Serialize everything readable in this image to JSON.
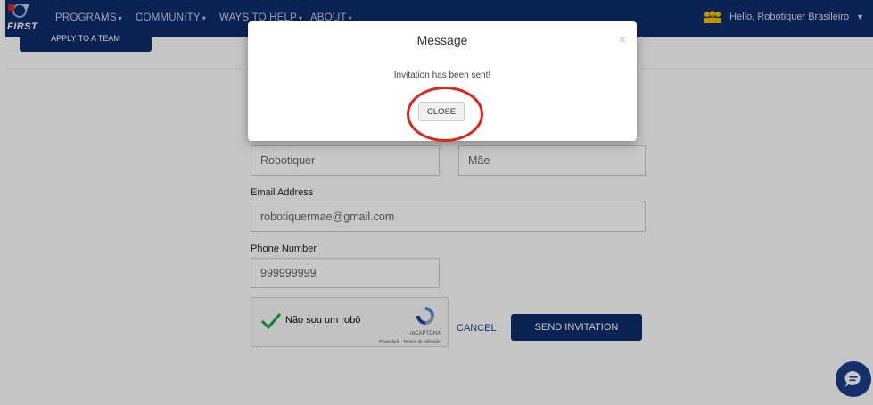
{
  "navbar": {
    "logo_text": "FIRST",
    "items": [
      {
        "label": "PROGRAMS"
      },
      {
        "label": "COMMUNITY"
      },
      {
        "label": "WAYS TO HELP"
      },
      {
        "label": "ABOUT"
      }
    ],
    "greeting": "Hello, Robotiquer Brasileiro"
  },
  "page": {
    "apply_button_label": "APPLY TO A TEAM"
  },
  "form": {
    "first_name_value": "Robotiquer",
    "last_name_value": "Mãe",
    "email_label": "Email Address",
    "email_value": "robotiquermae@gmail.com",
    "phone_label": "Phone Number",
    "phone_value": "999999999",
    "recaptcha": {
      "label": "Não sou um robô",
      "brand": "reCAPTCHA",
      "links": "Privacidade - Termos de Utilização"
    },
    "cancel_label": "CANCEL",
    "send_label": "SEND INVITATION"
  },
  "modal": {
    "title": "Message",
    "close_glyph": "×",
    "message": "Invitation has been sent!",
    "close_button_label": "CLOSE"
  },
  "colors": {
    "navbar": "#0f2d6b",
    "highlight": "#e32319",
    "primary_button": "#0f2d6b"
  },
  "icons": [
    "first-logo-icon",
    "users-icon",
    "caret-down-icon",
    "check-icon",
    "recaptcha-icon",
    "chat-icon"
  ]
}
